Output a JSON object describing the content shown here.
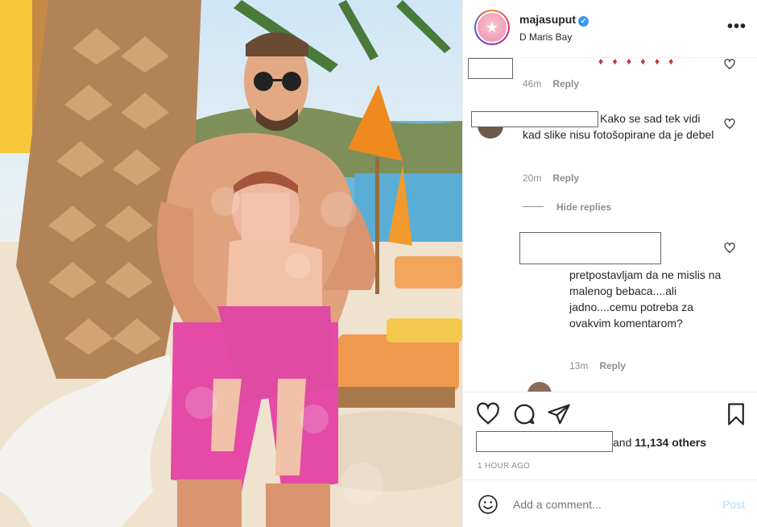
{
  "post": {
    "username": "majasuput",
    "verified_mark": "✓",
    "location": "D Maris Bay",
    "more_icon": "•••"
  },
  "comments": [
    {
      "text_top_fragment": "♦ ♦ ♦ ♦ ♦ ♦",
      "time": "46m",
      "reply": "Reply"
    },
    {
      "text": "Kako se sad tek vidi kad slike nisu fotošopirane da je debel",
      "time": "20m",
      "reply": "Reply"
    }
  ],
  "hide_replies": "Hide replies",
  "reply_comment": {
    "text": "pretpostavljam da ne mislis na malenog bebaca....ali jadno....cemu potreba za ovakvim komentarom?",
    "time": "13m",
    "reply": "Reply"
  },
  "likes": {
    "suffix": "and",
    "count": "11,134 others"
  },
  "timestamp": "1 HOUR AGO",
  "add_comment": {
    "placeholder": "Add a comment...",
    "post_label": "Post"
  },
  "colors": {
    "accent": "#3897f0",
    "post_disabled": "#b2dffc",
    "meta": "#8e8e8e"
  }
}
